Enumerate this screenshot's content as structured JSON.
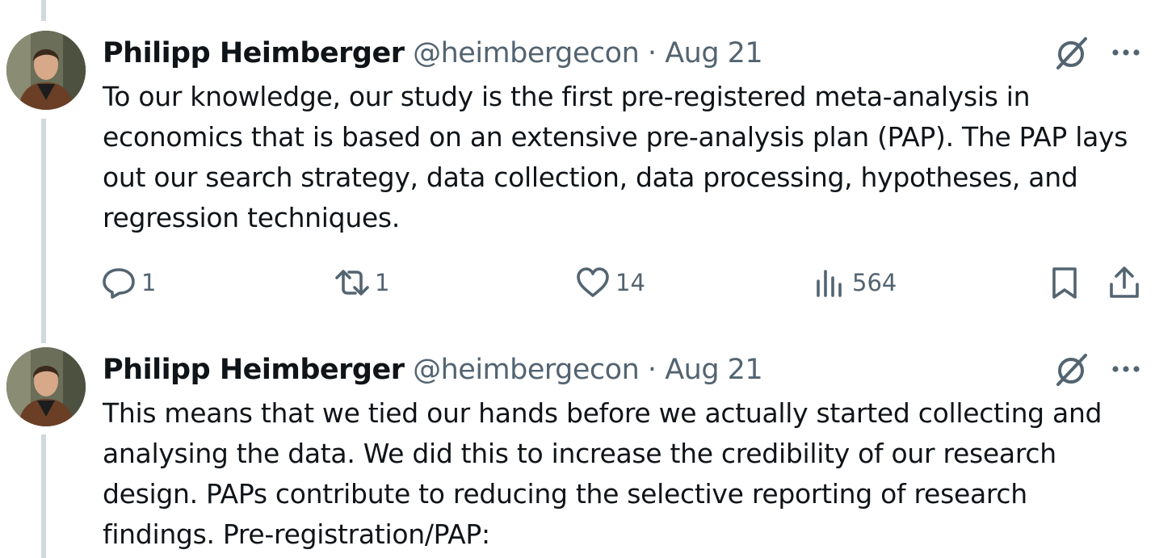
{
  "tweets": [
    {
      "author": "Philipp Heimberger",
      "handle": "@heimbergecon",
      "separator": "·",
      "date": "Aug 21",
      "text": "To our knowledge, our study is the first pre-registered meta-analysis in economics that is based on an extensive pre-analysis plan (PAP). The PAP lays out our search strategy, data collection, data processing, hypotheses, and regression techniques.",
      "replies": "1",
      "retweets": "1",
      "likes": "14",
      "views": "564"
    },
    {
      "author": "Philipp Heimberger",
      "handle": "@heimbergecon",
      "separator": "·",
      "date": "Aug 21",
      "text": "This means that we tied our hands before we actually started collecting and analysing the data. We did this to increase the credibility of our research design. PAPs contribute to reducing the selective reporting of research findings. Pre-registration/PAP:"
    }
  ],
  "icons": {
    "grok": "grok-icon",
    "more": "more-icon",
    "reply": "reply-icon",
    "retweet": "retweet-icon",
    "like": "like-icon",
    "views": "views-icon",
    "bookmark": "bookmark-icon",
    "share": "share-icon"
  },
  "colors": {
    "text": "#0f1419",
    "secondary": "#536471",
    "thread_line": "#cfd9de"
  }
}
